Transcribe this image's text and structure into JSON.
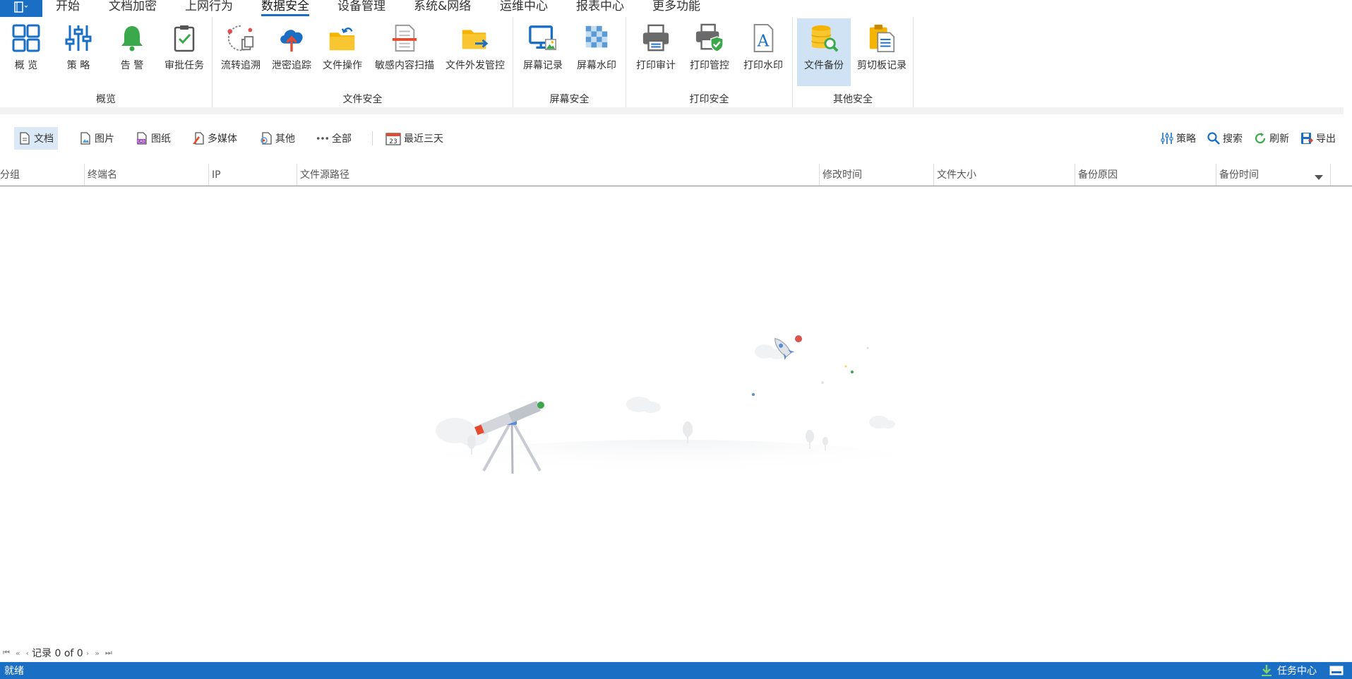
{
  "menu": {
    "app_icon": "notebook-icon",
    "items": [
      {
        "label": "开始"
      },
      {
        "label": "文档加密"
      },
      {
        "label": "上网行为"
      },
      {
        "label": "数据安全"
      },
      {
        "label": "设备管理"
      },
      {
        "label": "系统&网络"
      },
      {
        "label": "运维中心"
      },
      {
        "label": "报表中心"
      },
      {
        "label": "更多功能"
      }
    ],
    "active": "数据安全"
  },
  "ribbon": {
    "groups": [
      {
        "title": "概览",
        "buttons": [
          {
            "label": "概 览",
            "icon": "grid-icon"
          },
          {
            "label": "策 略",
            "icon": "sliders-icon"
          },
          {
            "label": "告 警",
            "icon": "bell-icon"
          },
          {
            "label": "审批任务",
            "icon": "clipboard-check-icon"
          }
        ]
      },
      {
        "title": "文件安全",
        "buttons": [
          {
            "label": "流转追溯",
            "icon": "trace-icon"
          },
          {
            "label": "泄密追踪",
            "icon": "cloud-upload-icon"
          },
          {
            "label": "文件操作",
            "icon": "folder-arrow-icon"
          },
          {
            "label": "敏感内容扫描",
            "icon": "document-scan-icon"
          },
          {
            "label": "文件外发管控",
            "icon": "folder-send-icon"
          }
        ]
      },
      {
        "title": "屏幕安全",
        "buttons": [
          {
            "label": "屏幕记录",
            "icon": "monitor-image-icon"
          },
          {
            "label": "屏幕水印",
            "icon": "watermark-icon"
          }
        ]
      },
      {
        "title": "打印安全",
        "buttons": [
          {
            "label": "打印审计",
            "icon": "printer-icon"
          },
          {
            "label": "打印管控",
            "icon": "printer-shield-icon"
          },
          {
            "label": "打印水印",
            "icon": "letter-a-document-icon"
          }
        ]
      },
      {
        "title": "其他安全",
        "buttons": [
          {
            "label": "文件备份",
            "icon": "database-search-icon",
            "selected": true
          },
          {
            "label": "剪切板记录",
            "icon": "clipboard-icon"
          }
        ]
      }
    ]
  },
  "filters": {
    "items": [
      {
        "label": "文档",
        "icon": "document-icon",
        "active": true
      },
      {
        "label": "图片",
        "icon": "image-file-icon"
      },
      {
        "label": "图纸",
        "icon": "cad-file-icon"
      },
      {
        "label": "多媒体",
        "icon": "media-file-icon"
      },
      {
        "label": "其他",
        "icon": "other-file-icon"
      },
      {
        "label": "全部",
        "icon": "ellipsis-icon"
      }
    ],
    "date_range": {
      "label": "最近三天",
      "icon": "calendar-icon",
      "calendar_day": "23"
    },
    "actions": [
      {
        "label": "策略",
        "icon": "sliders-icon"
      },
      {
        "label": "搜索",
        "icon": "search-icon"
      },
      {
        "label": "刷新",
        "icon": "refresh-icon"
      },
      {
        "label": "导出",
        "icon": "export-icon"
      }
    ]
  },
  "table": {
    "columns": [
      "分组",
      "终端名",
      "IP",
      "文件源路径",
      "修改时间",
      "文件大小",
      "备份原因",
      "备份时间"
    ],
    "rows": []
  },
  "pager": {
    "text": "记录 0 of 0"
  },
  "status": {
    "text": "就绪",
    "task_center": "任务中心"
  },
  "colors": {
    "accent": "#1a6fc4",
    "selected_bg": "#cfe3f5"
  }
}
